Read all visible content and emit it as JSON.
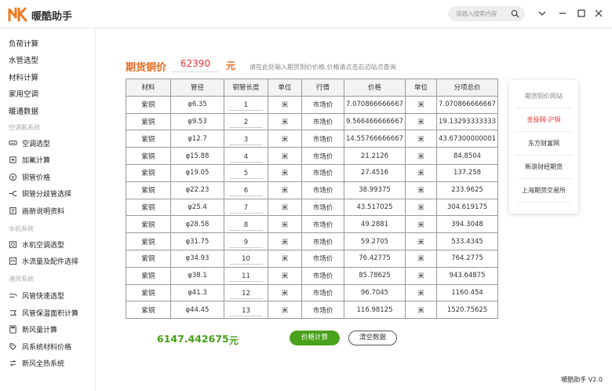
{
  "app": {
    "title": "暖酷助手",
    "version": "暖酷助手 V2.0"
  },
  "search": {
    "placeholder": "请输入搜索内容"
  },
  "sidebar": {
    "top_items": [
      "负荷计算",
      "水管选型",
      "材料计算",
      "家用空调",
      "暖通数据"
    ],
    "sections": [
      {
        "heading": "空调氟系统",
        "items": [
          "空调选型",
          "加氟计算",
          "铜管价格",
          "铜管分歧管选择",
          "画册说明资料"
        ]
      },
      {
        "heading": "水机系统",
        "items": [
          "水机空调选型",
          "水流量及配件选择"
        ]
      },
      {
        "heading": "通风系统",
        "items": [
          "风管快速选型",
          "风管保温面积计算",
          "新风量计算",
          "风系统材料价格",
          "新风全热系统"
        ]
      }
    ]
  },
  "main": {
    "futures_label": "期货铜价",
    "futures_value": "62390",
    "futures_unit": "元",
    "hint": "请在此处输入期货铜价价格,价格请点击右边站点查询",
    "table": {
      "headers": [
        "材料",
        "管径",
        "铜管长度",
        "单位",
        "行情",
        "价格",
        "单位",
        "分项总价"
      ],
      "rows": [
        [
          "紫铜",
          "φ6.35",
          "1",
          "米",
          "市场价",
          "7.070866666667",
          "米",
          "7.070866666667"
        ],
        [
          "紫铜",
          "φ9.53",
          "2",
          "米",
          "市场价",
          "9.566466666667",
          "米",
          "19.13293333333"
        ],
        [
          "紫铜",
          "φ12.7",
          "3",
          "米",
          "市场价",
          "14.55766666667",
          "米",
          "43.67300000001"
        ],
        [
          "紫铜",
          "φ15.88",
          "4",
          "米",
          "市场价",
          "21.2126",
          "米",
          "84.8504"
        ],
        [
          "紫铜",
          "φ19.05",
          "5",
          "米",
          "市场价",
          "27.4516",
          "米",
          "137.258"
        ],
        [
          "紫铜",
          "φ22.23",
          "6",
          "米",
          "市场价",
          "38.99375",
          "米",
          "233.9625"
        ],
        [
          "紫铜",
          "φ25.4",
          "7",
          "米",
          "市场价",
          "43.517025",
          "米",
          "304.619175"
        ],
        [
          "紫铜",
          "φ28.58",
          "8",
          "米",
          "市场价",
          "49.2881",
          "米",
          "394.3048"
        ],
        [
          "紫铜",
          "φ31.75",
          "9",
          "米",
          "市场价",
          "59.2705",
          "米",
          "533.4345"
        ],
        [
          "紫铜",
          "φ34.93",
          "10",
          "米",
          "市场价",
          "76.42775",
          "米",
          "764.2775"
        ],
        [
          "紫铜",
          "φ38.1",
          "11",
          "米",
          "市场价",
          "85.78625",
          "米",
          "943.64875"
        ],
        [
          "紫铜",
          "φ41.3",
          "12",
          "米",
          "市场价",
          "96.7045",
          "米",
          "1160.454"
        ],
        [
          "紫铜",
          "φ44.45",
          "13",
          "米",
          "市场价",
          "116.98125",
          "米",
          "1520.75625"
        ]
      ]
    },
    "total_value": "6147.442675",
    "total_unit": "元",
    "calc_button": "价格计算",
    "clear_button": "清空数据"
  },
  "links_panel": {
    "title": "期货铜价网站",
    "items": [
      "金投网-沪铜",
      "东方财富网",
      "新浪财经期货",
      "上海期货交易所"
    ]
  },
  "colors": {
    "accent_orange": "#e86a20",
    "price_red": "#e33333",
    "green": "#4aa21c",
    "link_red": "#d33333"
  }
}
